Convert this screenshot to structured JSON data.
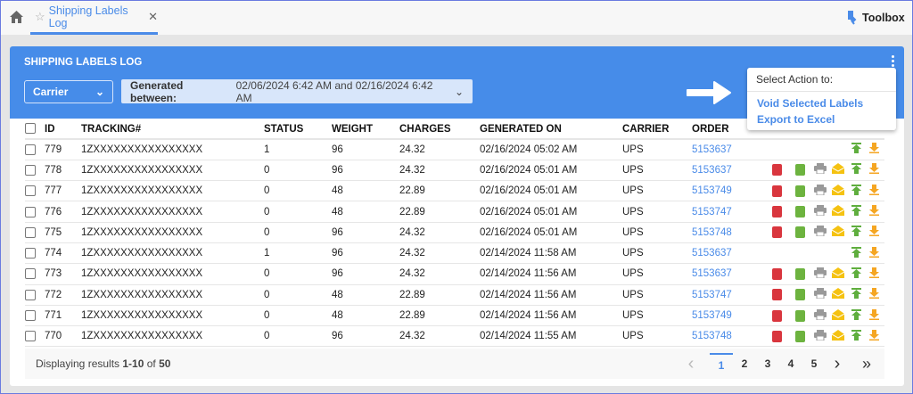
{
  "topbar": {
    "tab_label": "Shipping Labels Log",
    "toolbox_label": "Toolbox"
  },
  "header": {
    "title": "SHIPPING LABELS LOG",
    "carrier_label": "Carrier",
    "date_label": "Generated between:",
    "date_value": "02/06/2024 6:42 AM and 02/16/2024 6:42 AM"
  },
  "menu": {
    "title": "Select Action to:",
    "items": [
      "Void Selected Labels",
      "Export to Excel"
    ]
  },
  "columns": [
    "ID",
    "TRACKING#",
    "STATUS",
    "WEIGHT",
    "CHARGES",
    "GENERATED ON",
    "CARRIER",
    "ORDER"
  ],
  "rows": [
    {
      "id": "779",
      "tracking": "1ZXXXXXXXXXXXXXXXX",
      "status": "1",
      "weight": "96",
      "charges": "24.32",
      "generated": "02/16/2024 05:02 AM",
      "carrier": "UPS",
      "order": "5153637",
      "full_icons": false
    },
    {
      "id": "778",
      "tracking": "1ZXXXXXXXXXXXXXXXX",
      "status": "0",
      "weight": "96",
      "charges": "24.32",
      "generated": "02/16/2024 05:01 AM",
      "carrier": "UPS",
      "order": "5153637",
      "full_icons": true
    },
    {
      "id": "777",
      "tracking": "1ZXXXXXXXXXXXXXXXX",
      "status": "0",
      "weight": "48",
      "charges": "22.89",
      "generated": "02/16/2024 05:01 AM",
      "carrier": "UPS",
      "order": "5153749",
      "full_icons": true
    },
    {
      "id": "776",
      "tracking": "1ZXXXXXXXXXXXXXXXX",
      "status": "0",
      "weight": "48",
      "charges": "22.89",
      "generated": "02/16/2024 05:01 AM",
      "carrier": "UPS",
      "order": "5153747",
      "full_icons": true
    },
    {
      "id": "775",
      "tracking": "1ZXXXXXXXXXXXXXXXX",
      "status": "0",
      "weight": "96",
      "charges": "24.32",
      "generated": "02/16/2024 05:01 AM",
      "carrier": "UPS",
      "order": "5153748",
      "full_icons": true
    },
    {
      "id": "774",
      "tracking": "1ZXXXXXXXXXXXXXXXX",
      "status": "1",
      "weight": "96",
      "charges": "24.32",
      "generated": "02/14/2024 11:58 AM",
      "carrier": "UPS",
      "order": "5153637",
      "full_icons": false
    },
    {
      "id": "773",
      "tracking": "1ZXXXXXXXXXXXXXXXX",
      "status": "0",
      "weight": "96",
      "charges": "24.32",
      "generated": "02/14/2024 11:56 AM",
      "carrier": "UPS",
      "order": "5153637",
      "full_icons": true
    },
    {
      "id": "772",
      "tracking": "1ZXXXXXXXXXXXXXXXX",
      "status": "0",
      "weight": "48",
      "charges": "22.89",
      "generated": "02/14/2024 11:56 AM",
      "carrier": "UPS",
      "order": "5153747",
      "full_icons": true
    },
    {
      "id": "771",
      "tracking": "1ZXXXXXXXXXXXXXXXX",
      "status": "0",
      "weight": "48",
      "charges": "22.89",
      "generated": "02/14/2024 11:56 AM",
      "carrier": "UPS",
      "order": "5153749",
      "full_icons": true
    },
    {
      "id": "770",
      "tracking": "1ZXXXXXXXXXXXXXXXX",
      "status": "0",
      "weight": "96",
      "charges": "24.32",
      "generated": "02/14/2024 11:55 AM",
      "carrier": "UPS",
      "order": "5153748",
      "full_icons": true
    }
  ],
  "footer": {
    "prefix": "Displaying results ",
    "range": "1-10",
    "of": " of ",
    "total": "50"
  },
  "pager": {
    "prev": "‹",
    "pages": [
      "1",
      "2",
      "3",
      "4",
      "5"
    ],
    "current": "1",
    "next": "›",
    "last": "»"
  },
  "colors": {
    "accent": "#468ce9",
    "link": "#4a8be8",
    "pdf": "#d9363e",
    "green": "#6db33f",
    "print": "#999999",
    "email": "#f5c211",
    "upload": "#5fae3e",
    "download": "#f5a623"
  }
}
